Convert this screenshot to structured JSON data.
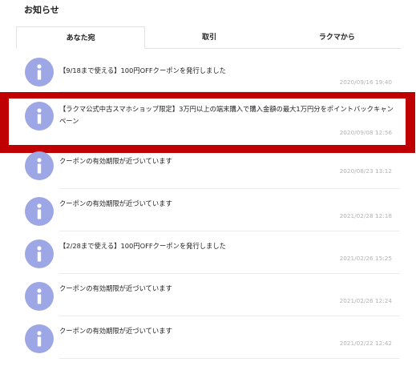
{
  "page": {
    "title": "お知らせ"
  },
  "tabs": [
    {
      "label": "あなた宛",
      "active": true
    },
    {
      "label": "取引",
      "active": false
    },
    {
      "label": "ラクマから",
      "active": false
    }
  ],
  "notifications": [
    {
      "message": "【9/18まで使える】100円OFFクーポンを発行しました",
      "date": "2020/09/16 19:40",
      "icon": "info-icon"
    },
    {
      "message": "【ラクマ公式中古スマホショップ限定】3万円以上の端末購入で購入金額の最大1万円分をポイントバックキャンペーン",
      "date": "2020/09/08 12:56",
      "icon": "info-icon",
      "highlighted": true
    },
    {
      "message": "クーポンの有効期限が近づいています",
      "date": "2020/08/23 13:12",
      "icon": "info-icon"
    },
    {
      "message": "クーポンの有効期限が近づいています",
      "date": "2021/02/28 12:18",
      "icon": "info-icon"
    },
    {
      "message": "【2/28まで使える】100円OFFクーポンを発行しました",
      "date": "2021/02/26 15:25",
      "icon": "info-icon"
    },
    {
      "message": "クーポンの有効期限が近づいています",
      "date": "2021/02/26 12:24",
      "icon": "info-icon"
    },
    {
      "message": "クーポンの有効期限が近づいています",
      "date": "2021/02/22 12:42",
      "icon": "info-icon"
    }
  ],
  "colors": {
    "highlight": "#c00000",
    "icon_bg": "#9ea7e6",
    "date": "#b5b5b5"
  }
}
